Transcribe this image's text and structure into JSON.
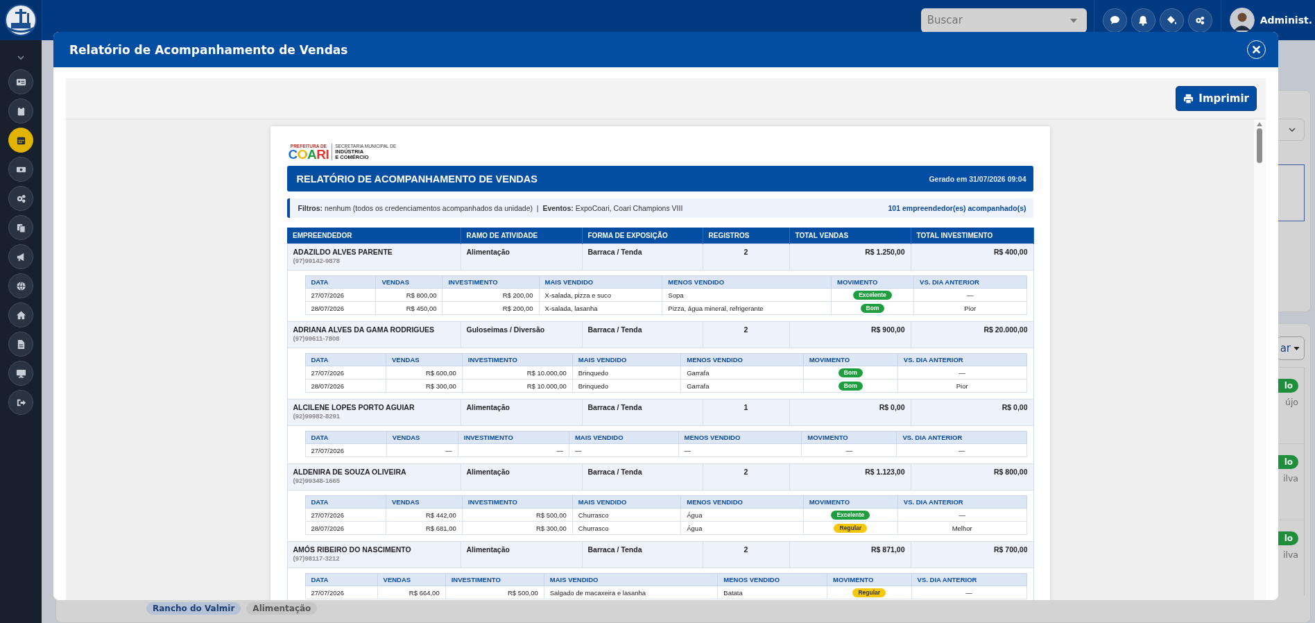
{
  "topbar": {
    "search": {
      "placeholder": "Buscar"
    },
    "user": {
      "name": "Administ."
    }
  },
  "sidebar": {
    "items": [
      {
        "selected": false
      },
      {
        "selected": false
      },
      {
        "selected": true
      },
      {
        "selected": false
      },
      {
        "selected": false
      },
      {
        "selected": false
      },
      {
        "selected": false
      },
      {
        "selected": false
      },
      {
        "selected": false
      },
      {
        "selected": false
      },
      {
        "selected": false
      },
      {
        "selected": false
      }
    ]
  },
  "background": {
    "dropdown_button": "ar",
    "rows": [
      {
        "badge": "lo",
        "name": "újo"
      },
      {
        "badge": "lo",
        "name": "ilva"
      },
      {
        "badge": "lo",
        "name": "ilva"
      }
    ],
    "chips": [
      "Rancho do Valmir",
      "Alimentação"
    ]
  },
  "modal": {
    "title": "Relatório de Acompanhamento de Vendas",
    "print_button": "Imprimir",
    "report": {
      "logo": {
        "top": "PREFEITURA DE",
        "name": "COARI",
        "dept_top": "SECRETARIA MUNICIPAL DE",
        "dept": "INDÚSTRIA",
        "dept2": "E COMÉRCIO"
      },
      "title": "RELATÓRIO DE ACOMPANHAMENTO DE VENDAS",
      "generated": "Gerado em 31/07/2026 09:04",
      "filters": "**Filtros:** nenhum (todos os credenciamentos acompanhados da unidade)  |  **Eventos:** ExpoCoari, Coari Champions VIII",
      "count": "101 empreendedor(es) acompanhado(s)",
      "columns": [
        "EMPREENDEDOR",
        "RAMO DE ATIVIDADE",
        "FORMA DE EXPOSIÇÃO",
        "REGISTROS",
        "TOTAL VENDAS",
        "TOTAL INVESTIMENTO"
      ],
      "entrepreneurs": [
        {
          "name": "ADAZILDO ALVES PARENTE",
          "phone": "(97)99142-9878",
          "activity": "Alimentação",
          "exposure": "Barraca / Tenda",
          "records": "2",
          "total_sales": "R$ 1.250,00",
          "total_investment": "R$ 400,00",
          "columns": [
            "DATA",
            "VENDAS",
            "INVESTIMENTO",
            "MAIS VENDIDO",
            "MENOS VENDIDO",
            "MOVIMENTO",
            "VS. DIA ANTERIOR"
          ],
          "days": [
            {
              "date": "27/07/2026",
              "sales": "R$ 800,00",
              "investment": "R$ 200,00",
              "best": "X-salada, pizza e suco",
              "worst": "Sopa",
              "movement": {
                "label": "Excelente",
                "kind": "success"
              },
              "vs": "—"
            },
            {
              "date": "28/07/2026",
              "sales": "R$ 450,00",
              "investment": "R$ 200,00",
              "best": "X-salada, lasanha",
              "worst": "Pizza, água mineral, refrigerante",
              "movement": {
                "label": "Bom",
                "kind": "success"
              },
              "vs": "Pior"
            }
          ]
        },
        {
          "name": "ADRIANA ALVES DA GAMA RODRIGUES",
          "phone": "(97)99611-7808",
          "activity": "Guloseimas / Diversão",
          "exposure": "Barraca / Tenda",
          "records": "2",
          "total_sales": "R$ 900,00",
          "total_investment": "R$ 20.000,00",
          "columns": [
            "DATA",
            "VENDAS",
            "INVESTIMENTO",
            "MAIS VENDIDO",
            "MENOS VENDIDO",
            "MOVIMENTO",
            "VS. DIA ANTERIOR"
          ],
          "days": [
            {
              "date": "27/07/2026",
              "sales": "R$ 600,00",
              "investment": "R$ 10.000,00",
              "best": "Brinquedo",
              "worst": "Garrafa",
              "movement": {
                "label": "Bom",
                "kind": "success"
              },
              "vs": "—"
            },
            {
              "date": "28/07/2026",
              "sales": "R$ 300,00",
              "investment": "R$ 10.000,00",
              "best": "Brinquedo",
              "worst": "Garrafa",
              "movement": {
                "label": "Bom",
                "kind": "success"
              },
              "vs": "Pior"
            }
          ]
        },
        {
          "name": "ALCILENE LOPES PORTO AGUIAR",
          "phone": "(92)99982-8291",
          "activity": "Alimentação",
          "exposure": "Barraca / Tenda",
          "records": "1",
          "total_sales": "R$ 0,00",
          "total_investment": "R$ 0,00",
          "columns": [
            "DATA",
            "VENDAS",
            "INVESTIMENTO",
            "MAIS VENDIDO",
            "MENOS VENDIDO",
            "MOVIMENTO",
            "VS. DIA ANTERIOR"
          ],
          "days": [
            {
              "date": "27/07/2026",
              "sales": "—",
              "investment": "—",
              "best": "—",
              "worst": "—",
              "movement": {
                "label": "—",
                "kind": "plain"
              },
              "vs": "—"
            }
          ]
        },
        {
          "name": "ALDENIRA DE SOUZA OLIVEIRA",
          "phone": "(92)99348-1665",
          "activity": "Alimentação",
          "exposure": "Barraca / Tenda",
          "records": "2",
          "total_sales": "R$ 1.123,00",
          "total_investment": "R$ 800,00",
          "columns": [
            "DATA",
            "VENDAS",
            "INVESTIMENTO",
            "MAIS VENDIDO",
            "MENOS VENDIDO",
            "MOVIMENTO",
            "VS. DIA ANTERIOR"
          ],
          "days": [
            {
              "date": "27/07/2026",
              "sales": "R$ 442,00",
              "investment": "R$ 500,00",
              "best": "Churrasco",
              "worst": "Água",
              "movement": {
                "label": "Excelente",
                "kind": "success"
              },
              "vs": "—"
            },
            {
              "date": "28/07/2026",
              "sales": "R$ 681,00",
              "investment": "R$ 300,00",
              "best": "Churrasco",
              "worst": "Água",
              "movement": {
                "label": "Regular",
                "kind": "warning"
              },
              "vs": "Melhor"
            }
          ]
        },
        {
          "name": "AMÓS RIBEIRO DO NASCIMENTO",
          "phone": "(97)98117-3212",
          "activity": "Alimentação",
          "exposure": "Barraca / Tenda",
          "records": "2",
          "total_sales": "R$ 871,00",
          "total_investment": "R$ 700,00",
          "columns": [
            "DATA",
            "VENDAS",
            "INVESTIMENTO",
            "MAIS VENDIDO",
            "MENOS VENDIDO",
            "MOVIMENTO",
            "VS. DIA ANTERIOR"
          ],
          "days": [
            {
              "date": "27/07/2026",
              "sales": "R$ 664,00",
              "investment": "R$ 500,00",
              "best": "Salgado de macaxeira e lasanha",
              "worst": "Batata",
              "movement": {
                "label": "Regular",
                "kind": "warning"
              },
              "vs": "—"
            }
          ]
        }
      ]
    }
  }
}
